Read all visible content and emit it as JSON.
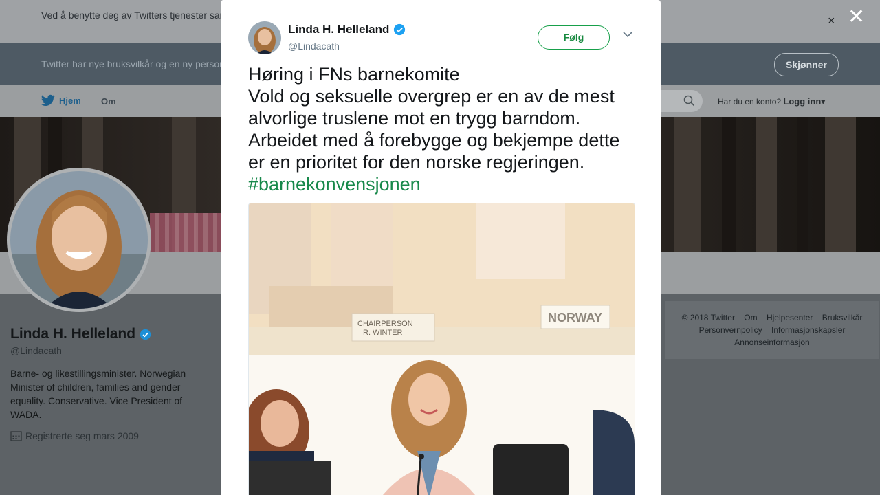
{
  "cookie_bar": {
    "text": "Ved å benytte deg av Twitters tjenester samtykker du til at vi bruker informasjonskapsler til bl.a. analyser, personalisering og annonser.",
    "close_icon": "×"
  },
  "modal_close_icon": "✕",
  "terms_bar": {
    "text": "Twitter har nye bruksvilkår og en ny personvernpolicy",
    "button": "Skjønner"
  },
  "nav": {
    "home": "Hjem",
    "about": "Om",
    "account_prompt": "Har du en konto?",
    "login": "Logg inn"
  },
  "profile": {
    "name": "Linda H. Helleland",
    "handle": "@Lindacath",
    "bio": "Barne- og likestillingsminister. Norwegian Minister of children, families and gender equality. Conservative. Vice President of WADA.",
    "joined": "Registrerte seg mars 2009"
  },
  "footer": {
    "links": [
      "© 2018 Twitter",
      "Om",
      "Hjelpesenter",
      "Bruksvilkår",
      "Personvernpolicy",
      "Informasjonskapsler",
      "Annonseinformasjon"
    ]
  },
  "tweet": {
    "name": "Linda H. Helleland",
    "handle": "@Lindacath",
    "follow": "Følg",
    "lines": [
      "Høring i FNs barnekomite",
      "Vold og seksuelle overgrep er en av de mest alvorlige truslene mot en trygg barndom. Arbeidet med å forebygge og bekjempe dette er en prioritet for den norske regjeringen."
    ],
    "hashtag": "#barnekonvensjonen",
    "photo_signs": [
      "CHAIRPERSON",
      "R. WINTER",
      "NORWAY"
    ]
  },
  "colors": {
    "accent_green": "#17884a",
    "verified_blue": "#1da1f2"
  }
}
